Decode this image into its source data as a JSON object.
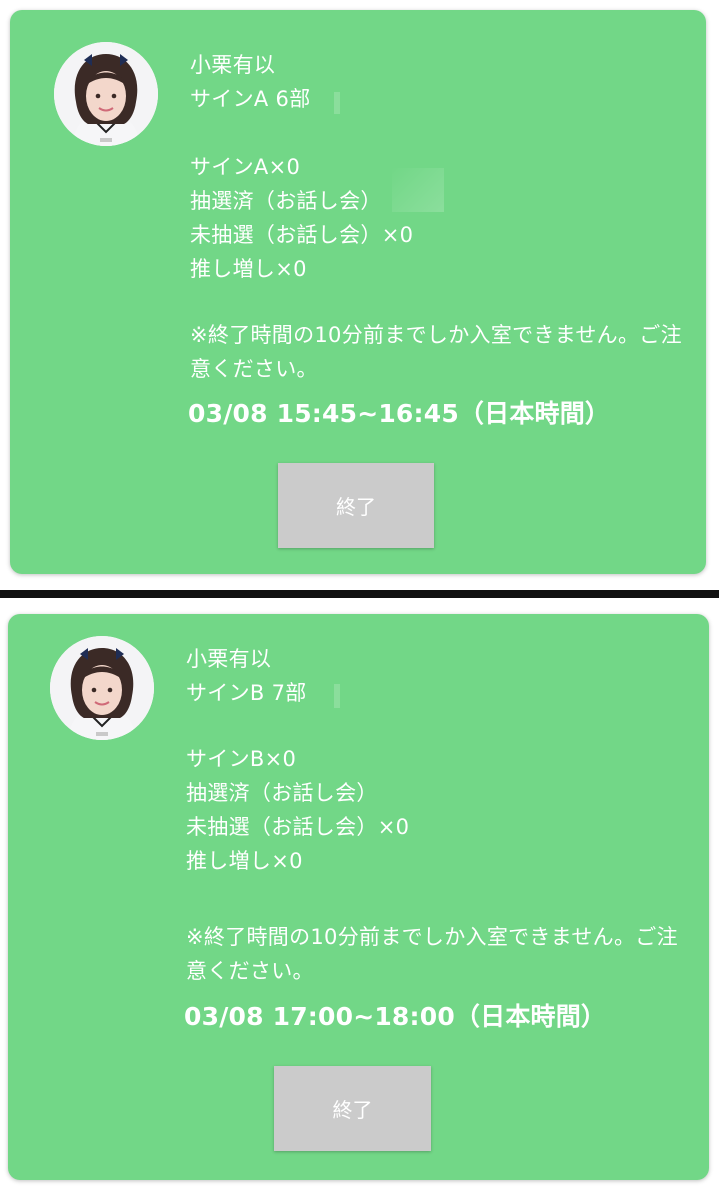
{
  "cards": [
    {
      "name": "小栗有以",
      "session": "サインA  6部",
      "items": [
        "サインA×0",
        "抽選済（お話し会）",
        "未抽選（お話し会）×0",
        "推し増し×0"
      ],
      "notice": "※終了時間の10分前までしか入室できません。ご注意ください。",
      "time": "03/08 15:45~16:45（日本時間）",
      "button_label": "終了"
    },
    {
      "name": "小栗有以",
      "session": "サインB  7部",
      "items": [
        "サインB×0",
        "抽選済（お話し会）",
        "未抽選（お話し会）×0",
        "推し増し×0"
      ],
      "notice": "※終了時間の10分前までしか入室できません。ご注意ください。",
      "time": "03/08 17:00~18:00（日本時間）",
      "button_label": "終了"
    }
  ],
  "colors": {
    "card_bg": "#72d787",
    "button_bg": "#cbcbcb",
    "text": "#ffffff"
  }
}
